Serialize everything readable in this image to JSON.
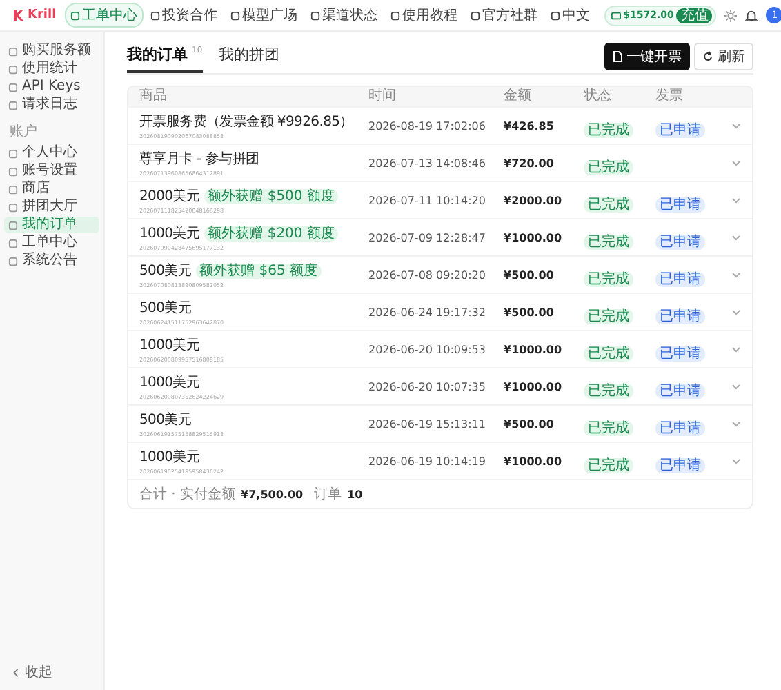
{
  "header": {
    "logo": "Krill",
    "nav": [
      {
        "label": "工单中心",
        "selected": true
      },
      {
        "label": "投资合作",
        "selected": false
      },
      {
        "label": "模型广场",
        "selected": false
      },
      {
        "label": "渠道状态",
        "selected": false
      },
      {
        "label": "使用教程",
        "selected": false
      },
      {
        "label": "官方社群",
        "selected": false
      },
      {
        "label": "中文",
        "selected": false
      }
    ],
    "balance": "$1572.00",
    "recharge": "充值",
    "avatar": "1"
  },
  "sidebar": {
    "groups": [
      {
        "items": [
          {
            "label": "购买服务额",
            "selected": false
          },
          {
            "label": "使用统计",
            "selected": false
          },
          {
            "label": "API Keys",
            "selected": false
          },
          {
            "label": "请求日志",
            "selected": false
          }
        ]
      },
      {
        "label": "账户",
        "items": [
          {
            "label": "个人中心",
            "selected": false
          },
          {
            "label": "账号设置",
            "selected": false
          },
          {
            "label": "商店",
            "selected": false
          },
          {
            "label": "拼团大厅",
            "selected": false
          },
          {
            "label": "我的订单",
            "selected": true
          },
          {
            "label": "工单中心",
            "selected": false
          },
          {
            "label": "系统公告",
            "selected": false
          }
        ]
      }
    ],
    "collapse": "收起"
  },
  "tabs": [
    {
      "label": "我的订单",
      "count": "10",
      "selected": true
    },
    {
      "label": "我的拼团",
      "selected": false
    }
  ],
  "actions": {
    "invoice": "一键开票",
    "refresh": "刷新"
  },
  "table": {
    "columns": [
      "商品",
      "时间",
      "金额",
      "状态",
      "发票"
    ],
    "rows": [
      {
        "name": "开票服务费（发票金额 ¥9926.85）",
        "order_no": "202608190902067083088858",
        "time": "2026-08-19 17:02:06",
        "amount": "¥426.85",
        "status": "已完成",
        "invoice": "已申请"
      },
      {
        "name": "尊享月卡 - 参与拼团",
        "order_no": "202607139608656864312891",
        "time": "2026-07-13 14:08:46",
        "amount": "¥720.00",
        "status": "已完成"
      },
      {
        "name": "2000美元",
        "bonus": "额外获赠 $500 额度",
        "order_no": "202607111825420048166298",
        "time": "2026-07-11 10:14:20",
        "amount": "¥2000.00",
        "status": "已完成",
        "invoice": "已申请"
      },
      {
        "name": "1000美元",
        "bonus": "额外获赠 $200 额度",
        "order_no": "202607090428475695177132",
        "time": "2026-07-09 12:28:47",
        "amount": "¥1000.00",
        "status": "已完成",
        "invoice": "已申请"
      },
      {
        "name": "500美元",
        "bonus": "额外获赠 $65 额度",
        "order_no": "202607080813820809582052",
        "time": "2026-07-08 09:20:20",
        "amount": "¥500.00",
        "status": "已完成",
        "invoice": "已申请"
      },
      {
        "name": "500美元",
        "order_no": "202606241511752963642870",
        "time": "2026-06-24 19:17:32",
        "amount": "¥500.00",
        "status": "已完成",
        "invoice": "已申请"
      },
      {
        "name": "1000美元",
        "order_no": "202606200809957516808185",
        "time": "2026-06-20 10:09:53",
        "amount": "¥1000.00",
        "status": "已完成",
        "invoice": "已申请"
      },
      {
        "name": "1000美元",
        "order_no": "202606200807352624224629",
        "time": "2026-06-20 10:07:35",
        "amount": "¥1000.00",
        "status": "已完成",
        "invoice": "已申请"
      },
      {
        "name": "500美元",
        "order_no": "202606191575158829515918",
        "time": "2026-06-19 15:13:11",
        "amount": "¥500.00",
        "status": "已完成",
        "invoice": "已申请"
      },
      {
        "name": "1000美元",
        "order_no": "202606190254195958436242",
        "time": "2026-06-19 10:14:19",
        "amount": "¥1000.00",
        "status": "已完成",
        "invoice": "已申请"
      }
    ]
  },
  "summary": {
    "label": "合计 · 实付金额",
    "amount": "¥7,500.00",
    "orders_label": "订单",
    "orders": "10"
  }
}
